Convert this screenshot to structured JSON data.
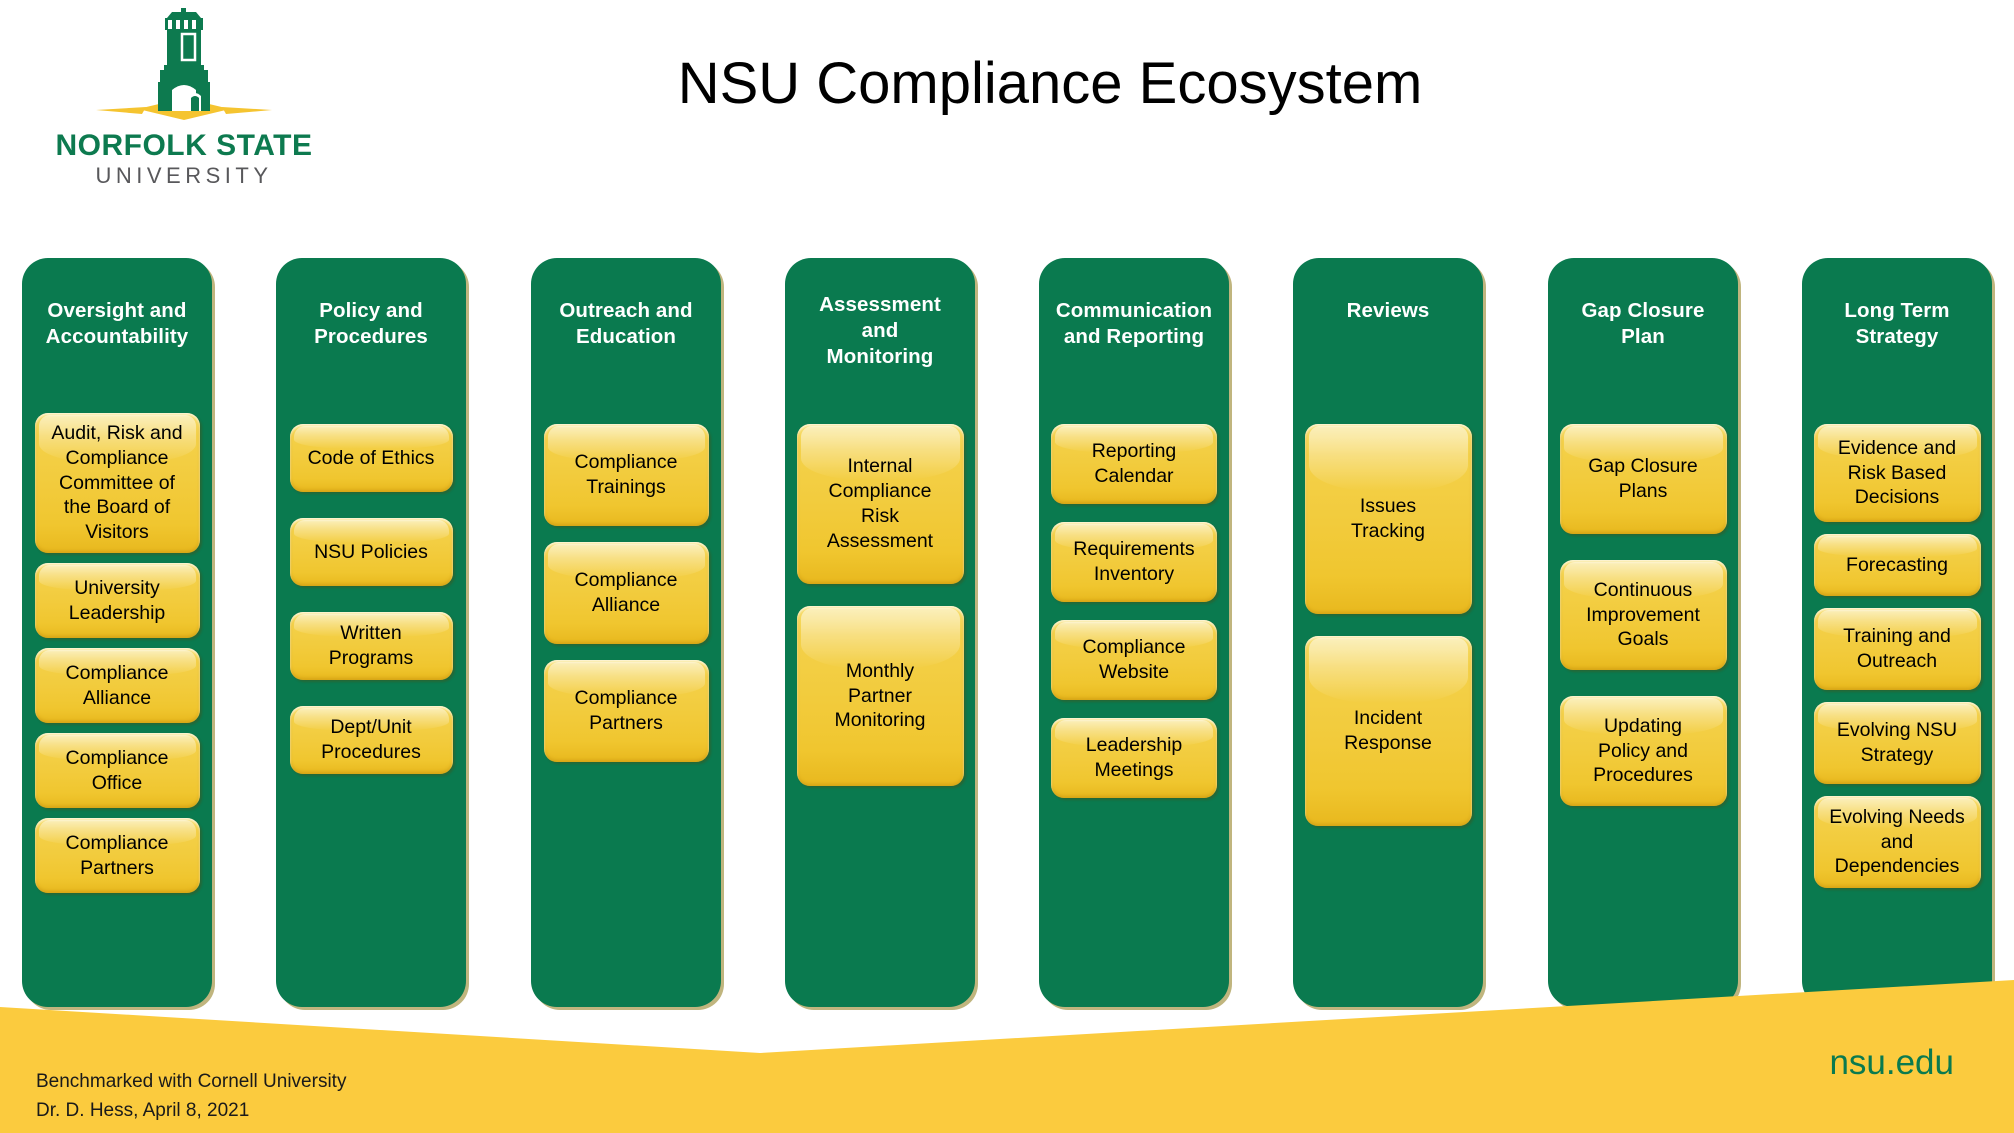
{
  "logo": {
    "mark_icon": "norfolk-state-tower-icon",
    "wordmark": "NORFOLK STATE",
    "subword": "UNIVERSITY",
    "green": "#0d7a4f",
    "gold": "#f5c430"
  },
  "title": "NSU Compliance Ecosystem",
  "colors": {
    "pillar_green": "#0a7a4f",
    "chip_yellow": "#f2cb3c",
    "footer_yellow": "#fbcb3e",
    "title_text": "#000000"
  },
  "pillars": [
    {
      "title": "Oversight and\nAccountability",
      "items": [
        "Audit, Risk and\nCompliance\nCommittee of\nthe  Board of\nVisitors",
        "University\nLeadership",
        "Compliance\nAlliance",
        "Compliance\nOffice",
        "Compliance\nPartners"
      ]
    },
    {
      "title": "Policy and\nProcedures",
      "items": [
        "Code of Ethics",
        "NSU Policies",
        "Written\nPrograms",
        "Dept/Unit\nProcedures"
      ]
    },
    {
      "title": "Outreach and\nEducation",
      "items": [
        "Compliance\nTrainings",
        "Compliance\nAlliance",
        "Compliance\nPartners"
      ]
    },
    {
      "title": "Assessment\nand\nMonitoring",
      "items": [
        "Internal\nCompliance\nRisk\nAssessment",
        "Monthly\nPartner\nMonitoring"
      ]
    },
    {
      "title": "Communication\nand Reporting",
      "items": [
        "Reporting\nCalendar",
        "Requirements\nInventory",
        "Compliance\nWebsite",
        "Leadership\nMeetings"
      ]
    },
    {
      "title": "Reviews",
      "items": [
        "Issues\nTracking",
        "Incident\nResponse"
      ]
    },
    {
      "title": "Gap Closure\nPlan",
      "items": [
        "Gap Closure\nPlans",
        "Continuous\nImprovement\nGoals",
        "Updating\nPolicy and\nProcedures"
      ]
    },
    {
      "title": "Long Term\nStrategy",
      "items": [
        "Evidence and\nRisk Based\nDecisions",
        "Forecasting",
        "Training and\nOutreach",
        "Evolving NSU\nStrategy",
        "Evolving Needs\nand\nDependencies"
      ]
    }
  ],
  "footer": {
    "note": "Benchmarked with Cornell University\nDr. D. Hess, April 8, 2021",
    "url": "nsu.edu"
  }
}
